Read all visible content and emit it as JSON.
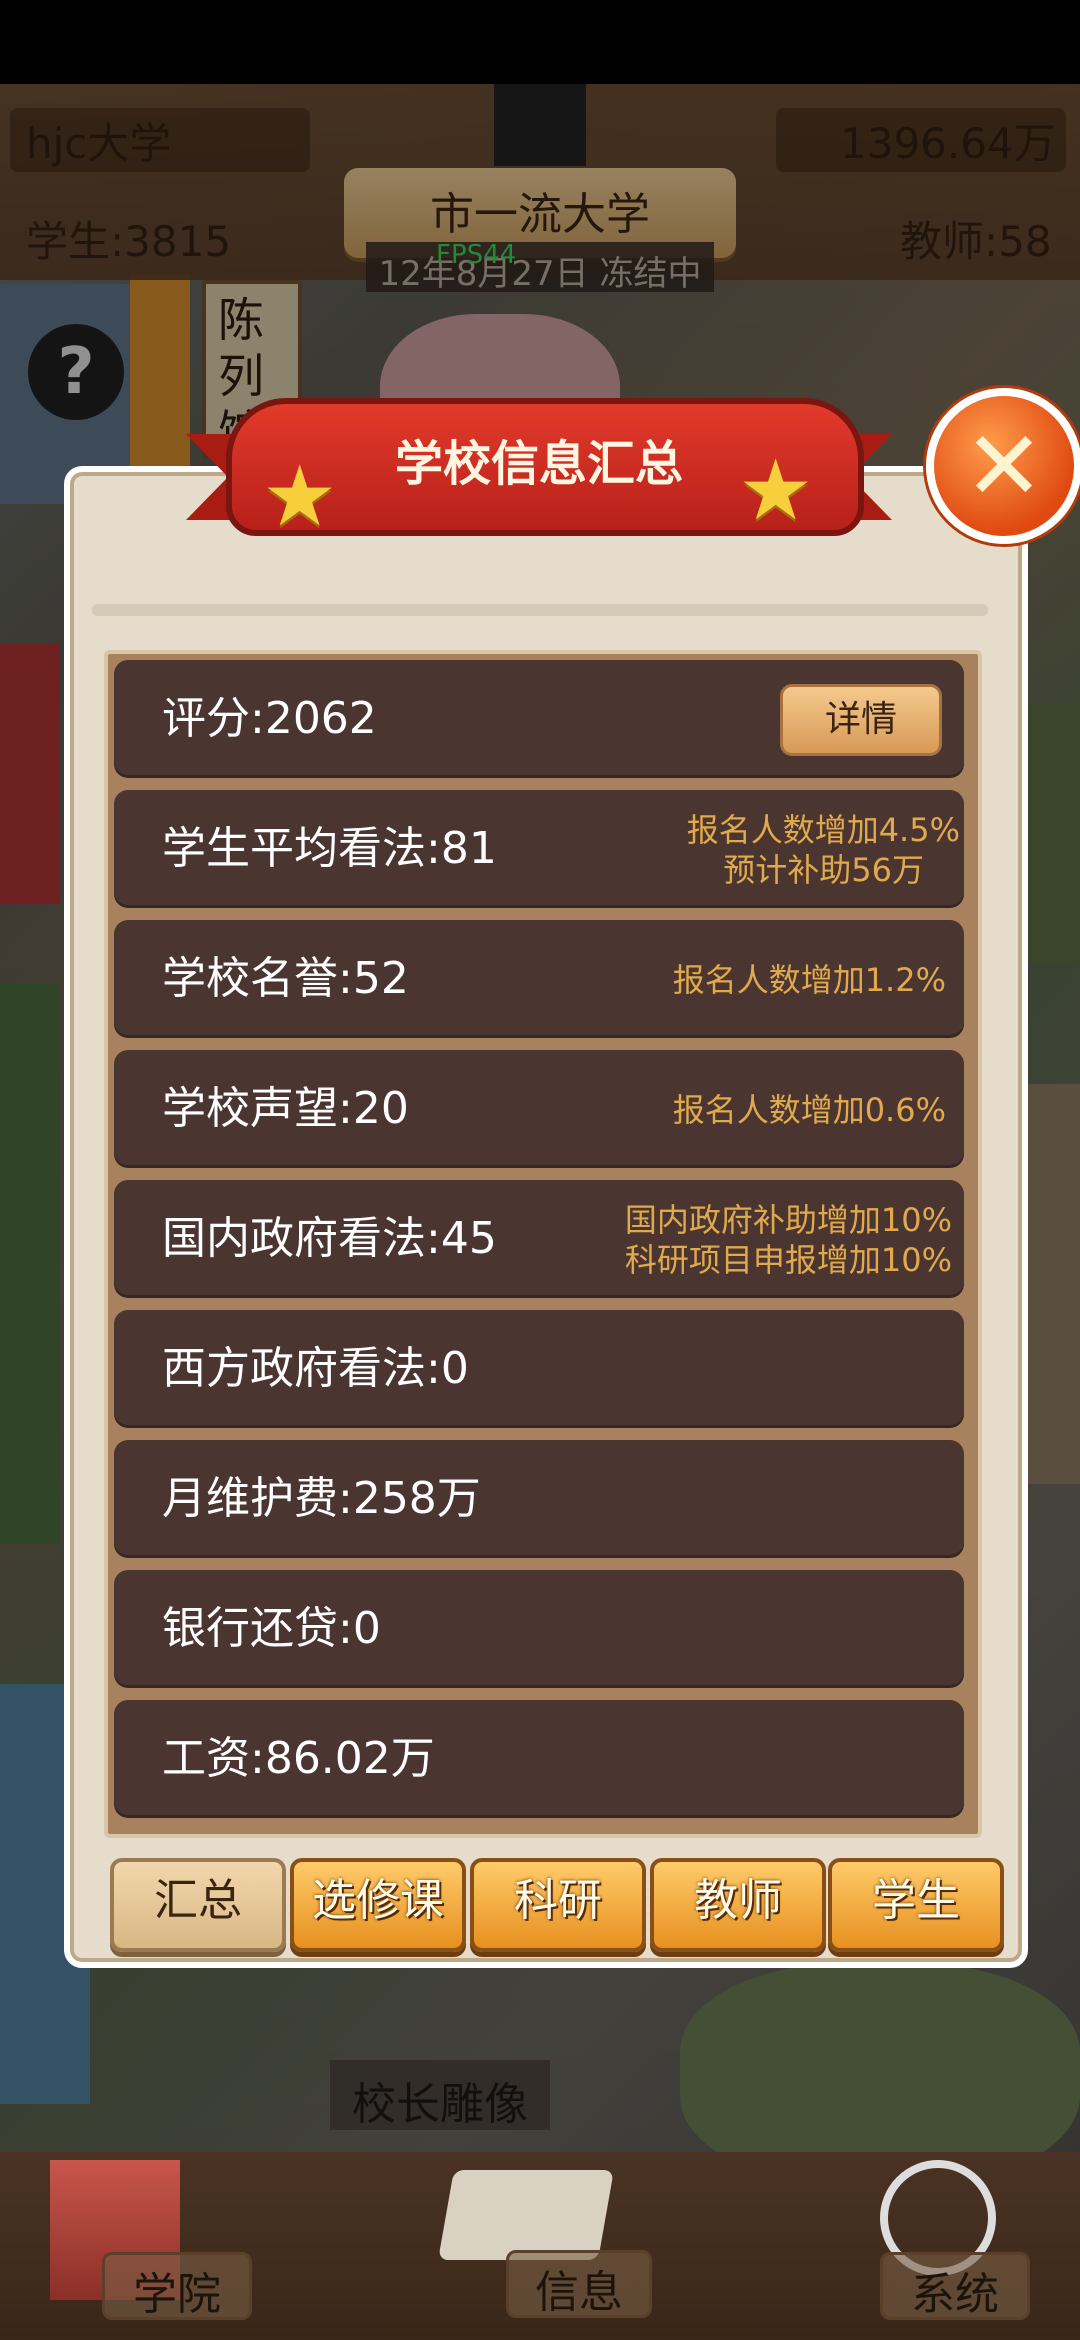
{
  "hud": {
    "school_name": "hjc大学",
    "money": "1396.64万",
    "students": "学生:3815",
    "teachers": "教师:58",
    "rank_title": "市一流大学",
    "fps": "FPS44",
    "date_status": "12年8月27日 冻结中"
  },
  "map": {
    "help_symbol": "?",
    "exhibition_hall": "陈列馆",
    "statue": "校长雕像"
  },
  "dialog": {
    "title": "学校信息汇总",
    "close_symbol": "✕",
    "detail_button": "详情",
    "rows": [
      {
        "label": "评分:2062",
        "note1": "",
        "note2": ""
      },
      {
        "label": "学生平均看法:81",
        "note1": "报名人数增加4.5%",
        "note2": "预计补助56万"
      },
      {
        "label": "学校名誉:52",
        "note1": "报名人数增加1.2%",
        "note2": ""
      },
      {
        "label": "学校声望:20",
        "note1": "报名人数增加0.6%",
        "note2": ""
      },
      {
        "label": "国内政府看法:45",
        "note1": "国内政府补助增加10%",
        "note2": "科研项目申报增加10%"
      },
      {
        "label": "西方政府看法:0",
        "note1": "",
        "note2": ""
      },
      {
        "label": "月维护费:258万",
        "note1": "",
        "note2": ""
      },
      {
        "label": "银行还贷:0",
        "note1": "",
        "note2": ""
      },
      {
        "label": "工资:86.02万",
        "note1": "",
        "note2": ""
      }
    ],
    "tabs": [
      "汇总",
      "选修课",
      "科研",
      "教师",
      "学生"
    ]
  },
  "bottom_nav": {
    "college": "学院",
    "info": "信息",
    "system": "系统"
  }
}
